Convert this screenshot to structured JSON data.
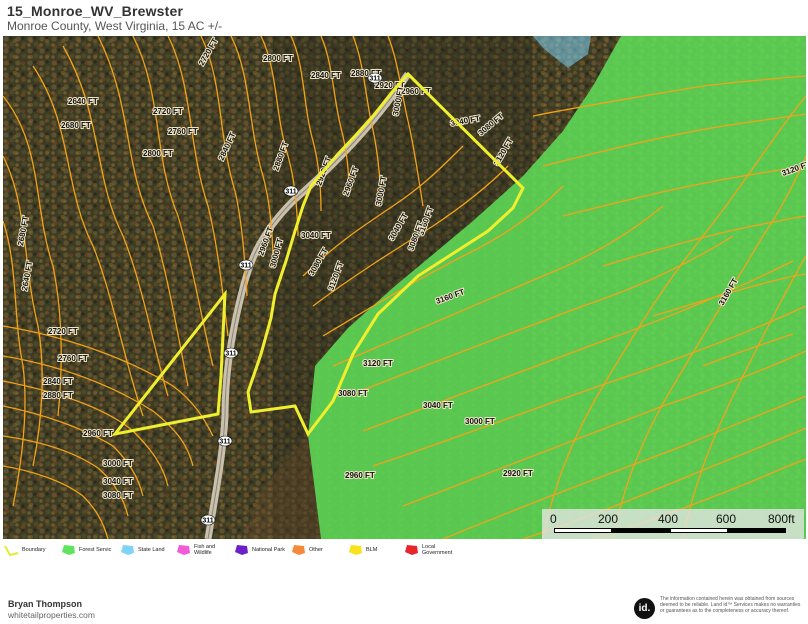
{
  "header": {
    "title": "15_Monroe_WV_Brewster",
    "subtitle": "Monroe County, West Virginia, 15 AC +/-"
  },
  "map": {
    "contour_labels": [
      "2720 FT",
      "2800 FT",
      "2840 FT",
      "2880 FT",
      "2920 FT",
      "2960 FT",
      "3000 FT",
      "3040 FT",
      "3080 FT",
      "3120 FT",
      "3160 FT",
      "2640 FT",
      "2680 FT",
      "2720 FT",
      "2760 FT",
      "2800 FT",
      "2840 FT",
      "2880 FT",
      "2920 FT",
      "2960 FT",
      "3000 FT",
      "3040 FT",
      "3080 FT",
      "2960 FT",
      "3000 FT",
      "3040 FT",
      "3080 FT",
      "3120 FT",
      "3160 FT",
      "3120 FT",
      "3080 FT",
      "3040 FT",
      "3000 FT",
      "2960 FT",
      "2920 FT",
      "2880 FT",
      "2840 FT",
      "2760 FT",
      "2720 FT",
      "2680 FT",
      "2640 FT",
      "2960 FT",
      "3000 FT",
      "3040 FT",
      "3080 FT",
      "3120 FT",
      "3160 FT"
    ],
    "road_shields": [
      "311",
      "311",
      "311",
      "311",
      "311",
      "311"
    ],
    "colors": {
      "boundary": "#f0ef2e",
      "forest_service": "#63e06a",
      "contour": "#f2a31a",
      "private_land": "#6b4a2b"
    }
  },
  "scale_bar": {
    "ticks": [
      "0",
      "200",
      "400",
      "600",
      "800ft"
    ]
  },
  "legend": {
    "items": [
      {
        "label": "Boundary",
        "color": "#e8e832",
        "icon": "boundary-icon"
      },
      {
        "label": "Forest Servic",
        "color": "#5ee45e",
        "icon": "shape-icon"
      },
      {
        "label": "State Land",
        "color": "#7fd3f5",
        "icon": "shape-icon"
      },
      {
        "label": "Fish and\nWildlife",
        "color": "#f35ad6",
        "icon": "shape-icon"
      },
      {
        "label": "National Park",
        "color": "#6a22c8",
        "icon": "shape-icon"
      },
      {
        "label": "Other",
        "color": "#f5893a",
        "icon": "shape-icon"
      },
      {
        "label": "BLM",
        "color": "#f8e21c",
        "icon": "shape-icon"
      },
      {
        "label": "Local\nGovernment",
        "color": "#e8242c",
        "icon": "shape-icon"
      }
    ]
  },
  "footer": {
    "author": "Bryan Thompson",
    "website": "whitetailproperties.com",
    "logo_text": "id.",
    "disclaimer": "The information contained herein was obtained from sources deemed to be reliable. Land id™ Services makes no warranties or guarantees as to the completeness or accuracy thereof."
  }
}
